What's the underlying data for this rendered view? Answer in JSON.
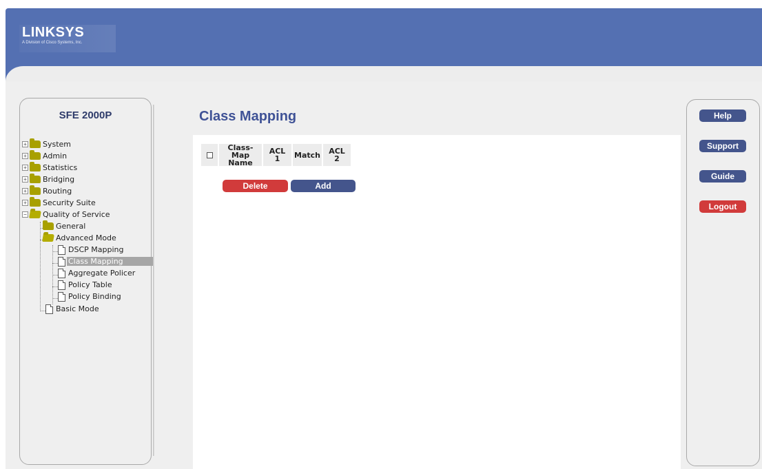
{
  "brand": {
    "name": "Linksys",
    "tagline": "A Division of Cisco Systems, Inc."
  },
  "device": {
    "name": "SFE 2000P"
  },
  "nav": {
    "system": "System",
    "admin": "Admin",
    "statistics": "Statistics",
    "bridging": "Bridging",
    "routing": "Routing",
    "security_suite": "Security Suite",
    "quality_of_service": "Quality of Service",
    "general": "General",
    "advanced_mode": "Advanced Mode",
    "dscp_mapping": "DSCP Mapping",
    "class_mapping": "Class Mapping",
    "aggregate_policer": "Aggregate Policer",
    "policy_table": "Policy Table",
    "policy_binding": "Policy Binding",
    "basic_mode": "Basic Mode",
    "selected": "Class Mapping"
  },
  "page": {
    "title": "Class Mapping"
  },
  "table": {
    "columns": [
      "Class-Map Name",
      "ACL 1",
      "Match",
      "ACL 2"
    ],
    "col_classmap_line1": "Class-Map",
    "col_classmap_line2": "Name",
    "col_acl1": "ACL 1",
    "col_match": "Match",
    "col_acl2": "ACL 2",
    "rows": []
  },
  "actions": {
    "delete_label": "Delete",
    "add_label": "Add"
  },
  "right_nav": {
    "help_label": "Help",
    "support_label": "Support",
    "guide_label": "Guide",
    "logout_label": "Logout"
  },
  "colors": {
    "header_blue": "#5470b2",
    "button_blue": "#44558c",
    "button_red": "#d13b3b",
    "title_blue": "#3f5296",
    "selected_gray": "#a6a6a6"
  }
}
